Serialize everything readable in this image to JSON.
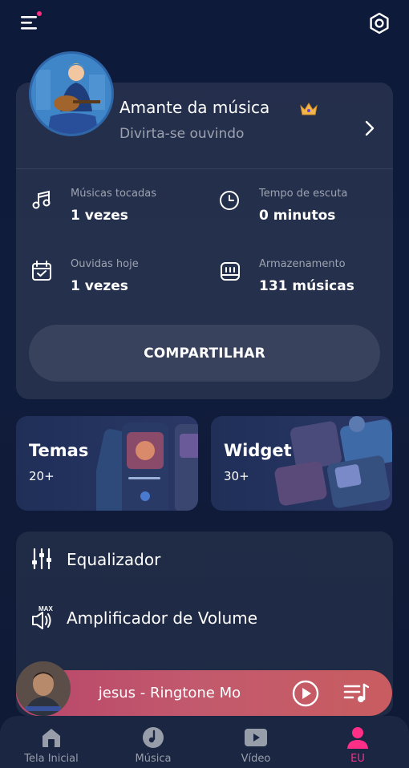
{
  "profile": {
    "name": "Amante da música",
    "subtitle": "Divirta-se ouvindo"
  },
  "stats": [
    {
      "label": "Músicas tocadas",
      "value": "1 vezes",
      "icon": "music-note-icon"
    },
    {
      "label": "Tempo de escuta",
      "value": "0 minutos",
      "icon": "clock-icon"
    },
    {
      "label": "Ouvidas hoje",
      "value": "1 vezes",
      "icon": "calendar-check-icon"
    },
    {
      "label": "Armazenamento",
      "value": "131 músicas",
      "icon": "storage-icon"
    }
  ],
  "share_label": "COMPARTILHAR",
  "promos": [
    {
      "title": "Temas",
      "count": "20+"
    },
    {
      "title": "Widget",
      "count": "30+"
    }
  ],
  "settings": [
    {
      "label": "Equalizador",
      "icon": "equalizer-icon"
    },
    {
      "label": "Amplificador de Volume",
      "icon": "volume-max-icon",
      "badge": "MAX"
    }
  ],
  "player": {
    "track": "Jesus - Ringtone Mo",
    "track_visible": "e jesus - Ringtone Mo"
  },
  "nav": [
    {
      "label": "Tela Inicial",
      "icon": "home-icon"
    },
    {
      "label": "Música",
      "icon": "disc-icon"
    },
    {
      "label": "Vídeo",
      "icon": "video-icon"
    },
    {
      "label": "EU",
      "icon": "person-icon",
      "active": true
    }
  ],
  "colors": {
    "accent": "#ff2e86",
    "player_bg": "#c05068",
    "background": "#0f1a38"
  }
}
